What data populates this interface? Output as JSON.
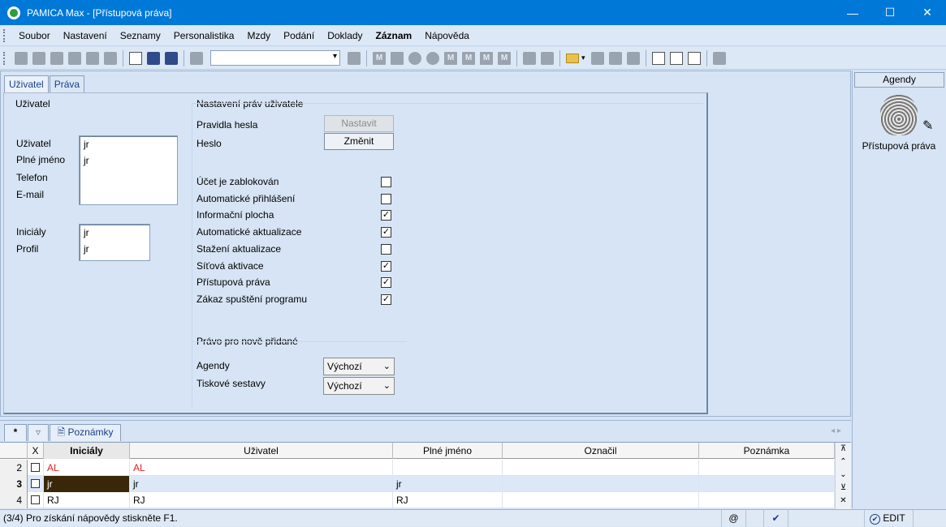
{
  "window": {
    "title": "PAMICA Max - [Přístupová práva]"
  },
  "menu": [
    {
      "label": "Soubor",
      "bold": false
    },
    {
      "label": "Nastavení",
      "bold": false
    },
    {
      "label": "Seznamy",
      "bold": false
    },
    {
      "label": "Personalistika",
      "bold": false
    },
    {
      "label": "Mzdy",
      "bold": false
    },
    {
      "label": "Podání",
      "bold": false
    },
    {
      "label": "Doklady",
      "bold": false
    },
    {
      "label": "Záznam",
      "bold": true
    },
    {
      "label": "Nápověda",
      "bold": false
    }
  ],
  "tabs": {
    "user": "Uživatel",
    "rights": "Práva"
  },
  "user_group": {
    "title": "Uživatel",
    "labels": {
      "user": "Uživatel",
      "full_name": "Plné jméno",
      "phone": "Telefon",
      "email": "E-mail",
      "initials": "Iniciály",
      "profile": "Profil"
    },
    "values": {
      "user": "jr",
      "full_name": "jr",
      "phone": "",
      "email": "",
      "initials": "jr",
      "profile": "jr"
    }
  },
  "rights_group": {
    "title": "Nastavení práv uživatele",
    "password_rules": "Pravidla hesla",
    "password": "Heslo",
    "set_button": "Nastavit",
    "change_button": "Změnit",
    "options": [
      {
        "label": "Účet je zablokován",
        "checked": false
      },
      {
        "label": "Automatické přihlášení",
        "checked": false
      },
      {
        "label": "Informační plocha",
        "checked": true
      },
      {
        "label": "Automatické aktualizace",
        "checked": true
      },
      {
        "label": "Stažení aktualizace",
        "checked": false
      },
      {
        "label": "Síťová aktivace",
        "checked": true
      },
      {
        "label": "Přístupová práva",
        "checked": true
      },
      {
        "label": "Zákaz spuštění programu",
        "checked": true
      }
    ],
    "new_rights": {
      "title": "Právo pro nově přidané",
      "agendy_label": "Agendy",
      "agendy_value": "Výchozí",
      "reports_label": "Tiskové sestavy",
      "reports_value": "Výchozí"
    }
  },
  "sidebar": {
    "header": "Agendy",
    "caption": "Přístupová práva"
  },
  "bottom_tabs": {
    "star": "*",
    "notes": "Poznámky"
  },
  "grid": {
    "columns": [
      "",
      "X",
      "Iniciály",
      "Uživatel",
      "Plné jméno",
      "Označil",
      "Poznámka"
    ],
    "rows": [
      {
        "num": "2",
        "initials": "AL",
        "user": "AL",
        "full_name": "",
        "marked": "",
        "note": "",
        "red": true,
        "selected": false
      },
      {
        "num": "3",
        "initials": "jr",
        "user": "jr",
        "full_name": "jr",
        "marked": "",
        "note": "",
        "red": false,
        "selected": true
      },
      {
        "num": "4",
        "initials": "RJ",
        "user": "RJ",
        "full_name": "RJ",
        "marked": "",
        "note": "",
        "red": false,
        "selected": false
      }
    ]
  },
  "status": {
    "text": "(3/4) Pro získání nápovědy stiskněte F1.",
    "at": "@",
    "mode": "EDIT"
  },
  "colors": {
    "titlebar": "#0078d7",
    "selection": "#3a2608",
    "accent_red": "#e02020"
  }
}
